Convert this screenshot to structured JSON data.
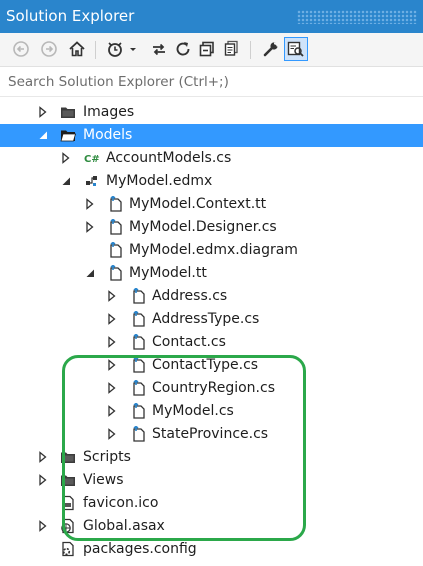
{
  "window": {
    "title": "Solution Explorer"
  },
  "toolbar": {
    "buttons": [
      {
        "name": "back-button",
        "icon": "back-icon"
      },
      {
        "name": "forward-button",
        "icon": "forward-icon"
      },
      {
        "name": "home-button",
        "icon": "home-icon"
      },
      {
        "name": "pending-changes-filter-button",
        "icon": "clock-icon"
      },
      {
        "name": "filter-dropdown-button",
        "icon": "chevron-down-icon"
      },
      {
        "name": "sync-with-active-document-button",
        "icon": "sync-icon"
      },
      {
        "name": "refresh-button",
        "icon": "refresh-icon"
      },
      {
        "name": "collapse-all-button",
        "icon": "collapse-all-icon"
      },
      {
        "name": "show-all-files-button",
        "icon": "show-all-files-icon"
      },
      {
        "name": "properties-button",
        "icon": "wrench-icon"
      },
      {
        "name": "preview-selected-items-button",
        "icon": "preview-icon"
      }
    ]
  },
  "search": {
    "placeholder": "Search Solution Explorer (Ctrl+;)"
  },
  "tree": {
    "items": [
      {
        "label": "Images",
        "expander": "collapsed",
        "icon": "folder-icon"
      },
      {
        "label": "Models",
        "expander": "expanded",
        "icon": "folder-open-icon",
        "selected": true
      },
      {
        "label": "AccountModels.cs",
        "expander": "collapsed",
        "icon": "csharp-file-icon"
      },
      {
        "label": "MyModel.edmx",
        "expander": "expanded",
        "icon": "edmx-file-icon"
      },
      {
        "label": "MyModel.Context.tt",
        "expander": "collapsed",
        "icon": "template-file-icon"
      },
      {
        "label": "MyModel.Designer.cs",
        "expander": "collapsed",
        "icon": "template-file-icon"
      },
      {
        "label": "MyModel.edmx.diagram",
        "expander": "none",
        "icon": "template-file-icon"
      },
      {
        "label": "MyModel.tt",
        "expander": "expanded",
        "icon": "template-file-icon"
      },
      {
        "label": "Address.cs",
        "expander": "collapsed",
        "icon": "template-file-icon"
      },
      {
        "label": "AddressType.cs",
        "expander": "collapsed",
        "icon": "template-file-icon"
      },
      {
        "label": "Contact.cs",
        "expander": "collapsed",
        "icon": "template-file-icon"
      },
      {
        "label": "ContactType.cs",
        "expander": "collapsed",
        "icon": "template-file-icon"
      },
      {
        "label": "CountryRegion.cs",
        "expander": "collapsed",
        "icon": "template-file-icon"
      },
      {
        "label": "MyModel.cs",
        "expander": "collapsed",
        "icon": "template-file-icon"
      },
      {
        "label": "StateProvince.cs",
        "expander": "collapsed",
        "icon": "template-file-icon"
      },
      {
        "label": "Scripts",
        "expander": "collapsed",
        "icon": "folder-icon"
      },
      {
        "label": "Views",
        "expander": "collapsed",
        "icon": "folder-icon"
      },
      {
        "label": "favicon.ico",
        "expander": "none",
        "icon": "ico-file-icon"
      },
      {
        "label": "Global.asax",
        "expander": "collapsed",
        "icon": "global-asax-icon"
      },
      {
        "label": "packages.config",
        "expander": "none",
        "icon": "config-file-icon"
      }
    ]
  },
  "colors": {
    "title_bar": "#2a85cc",
    "selection": "#3399ff",
    "highlight_border": "#2ba84a"
  }
}
